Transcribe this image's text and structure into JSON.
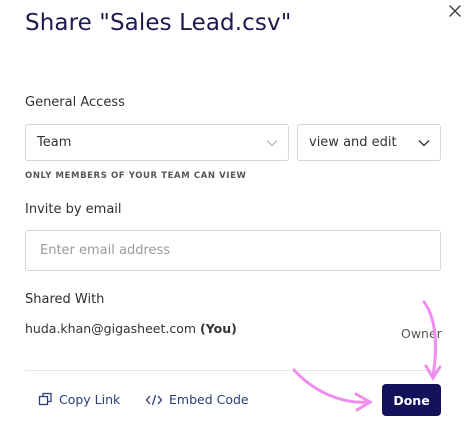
{
  "dialog": {
    "title": "Share \"Sales Lead.csv\""
  },
  "general_access": {
    "label": "General Access",
    "scope_value": "Team",
    "permission_value": "view and edit",
    "hint": "ONLY MEMBERS OF YOUR TEAM CAN VIEW"
  },
  "invite": {
    "label": "Invite by email",
    "placeholder": "Enter email address"
  },
  "shared_with": {
    "label": "Shared With",
    "entries": [
      {
        "email": "huda.khan@gigasheet.com",
        "tag": "(You)",
        "role": "Owner"
      }
    ]
  },
  "footer": {
    "copy_link": "Copy Link",
    "embed_code": "Embed Code",
    "done": "Done"
  },
  "annotation": {
    "arrow_color": "#f08ef0"
  }
}
